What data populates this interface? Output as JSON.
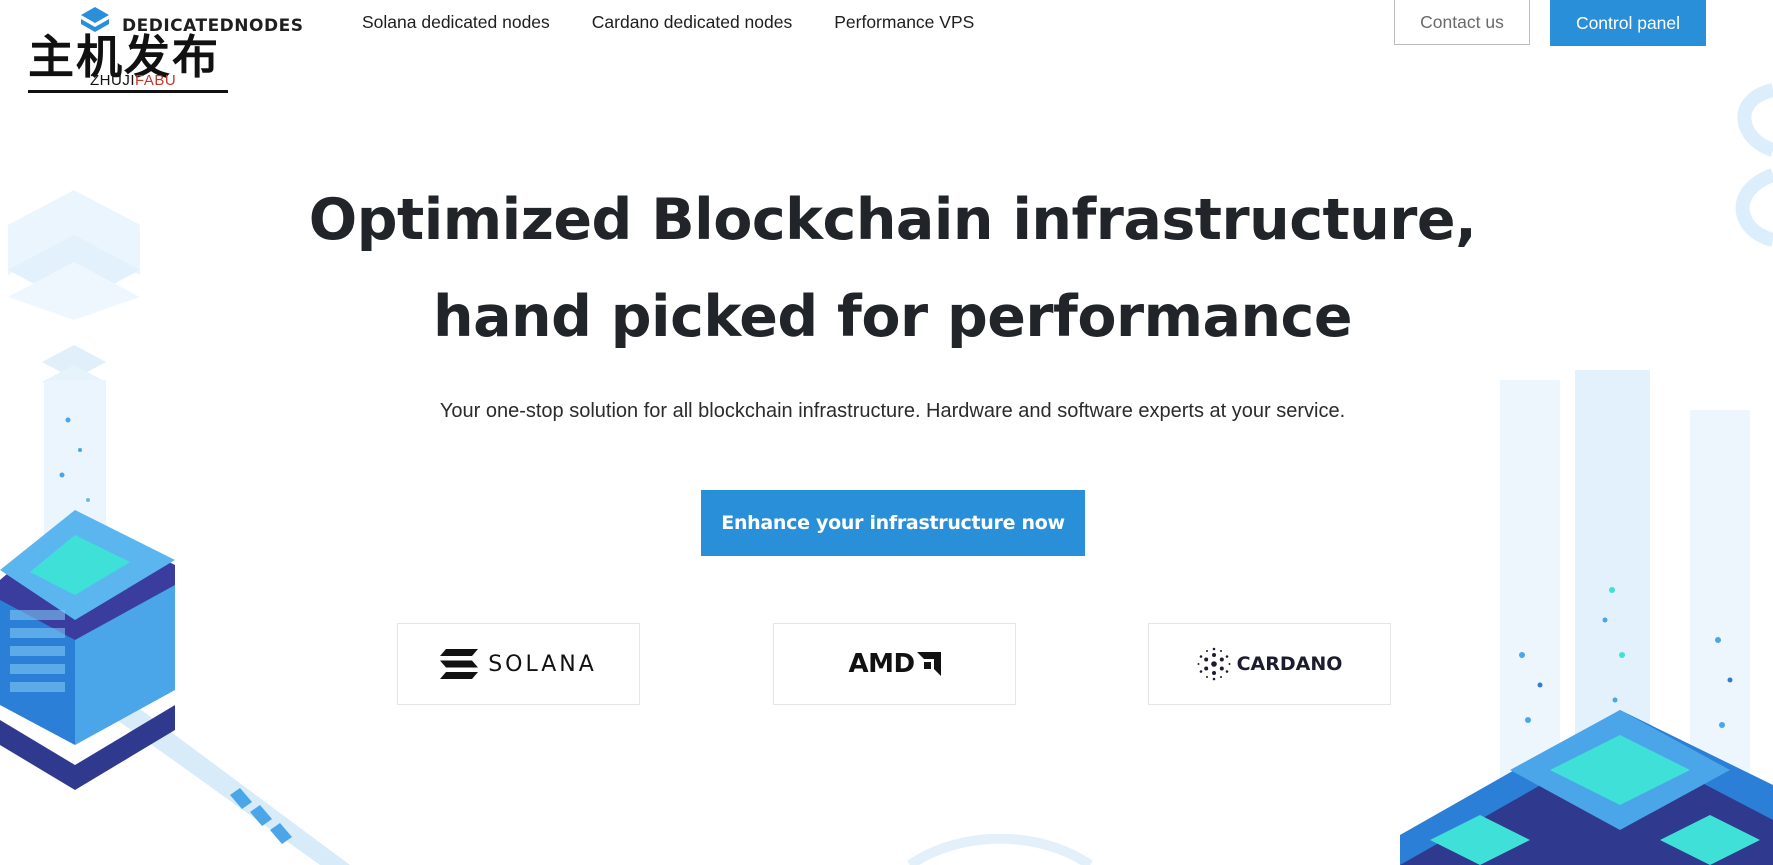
{
  "header": {
    "logo_name": "DEDICATEDNODES",
    "watermark_cn": "主机发布",
    "watermark_sub_a": "ZHUJI",
    "watermark_sub_b": "FABU",
    "nav": [
      {
        "label": "Solana dedicated nodes"
      },
      {
        "label": "Cardano dedicated nodes"
      },
      {
        "label": "Performance VPS"
      }
    ],
    "contact_label": "Contact us",
    "panel_label": "Control panel"
  },
  "hero": {
    "title_line1": "Optimized Blockchain infrastructure,",
    "title_line2": "hand picked for performance",
    "subtitle": "Your one-stop solution for all blockchain infrastructure. Hardware and software experts at your service.",
    "cta_label": "Enhance your infrastructure now"
  },
  "partners": [
    {
      "name": "SOLANA",
      "icon": "solana-icon"
    },
    {
      "name": "AMD",
      "icon": "amd-arrow-icon"
    },
    {
      "name": "CARDANO",
      "icon": "cardano-icon"
    }
  ],
  "colors": {
    "accent": "#2a8fd9",
    "text": "#212529",
    "deco_light": "#dbeefb",
    "deco_mid": "#4aa6e8",
    "deco_dark": "#2f3a8f",
    "deco_teal": "#3fe0d8"
  }
}
